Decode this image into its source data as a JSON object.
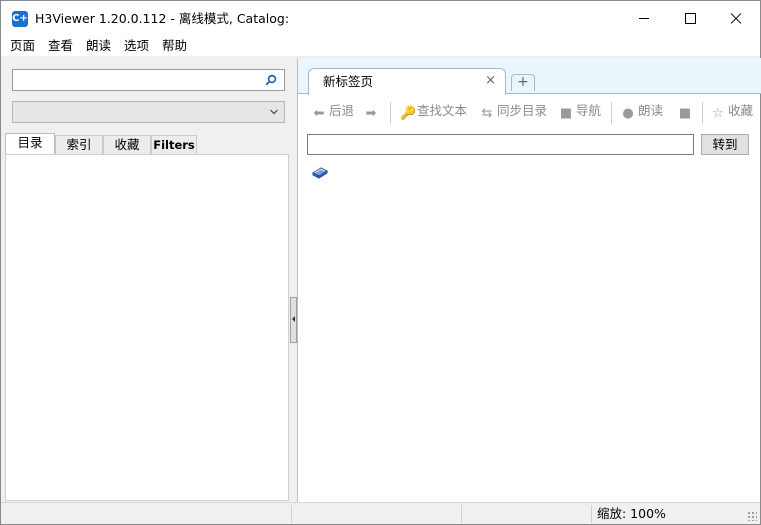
{
  "window": {
    "title": "H3Viewer 1.20.0.112 - 离线模式, Catalog:",
    "app_icon_glyph": "C+"
  },
  "menubar": {
    "items": [
      "页面",
      "查看",
      "朗读",
      "选项",
      "帮助"
    ]
  },
  "left_panel": {
    "search": {
      "value": "",
      "placeholder": ""
    },
    "combo": {
      "value": ""
    },
    "tabs": [
      "目录",
      "索引",
      "收藏",
      "Filters"
    ],
    "active_tab": "目录"
  },
  "right_panel": {
    "doc_tab": {
      "label": "新标签页",
      "close_glyph": "×"
    },
    "new_tab_glyph": "+",
    "toolbar": {
      "back": "后退",
      "find_text": "查找文本",
      "sync_toc": "同步目录",
      "navigate": "导航",
      "read_aloud": "朗读",
      "favorites": "收藏"
    },
    "address": {
      "value": ""
    },
    "goto_label": "转到"
  },
  "statusbar": {
    "zoom": "缩放: 100%"
  },
  "icons": {
    "back": "arrow-left-icon",
    "forward": "arrow-right-icon",
    "find": "key-icon",
    "sync": "sync-arrows-icon",
    "navigate": "nav-square-icon",
    "read": "speech-bubble-icon",
    "stop": "stop-square-icon",
    "favorite": "star-icon",
    "book": "book-icon"
  },
  "colors": {
    "tabstrip_bg": "#eaf6fb",
    "disabled_text": "#8b8b8b",
    "app_icon": "#1e6fd0"
  }
}
